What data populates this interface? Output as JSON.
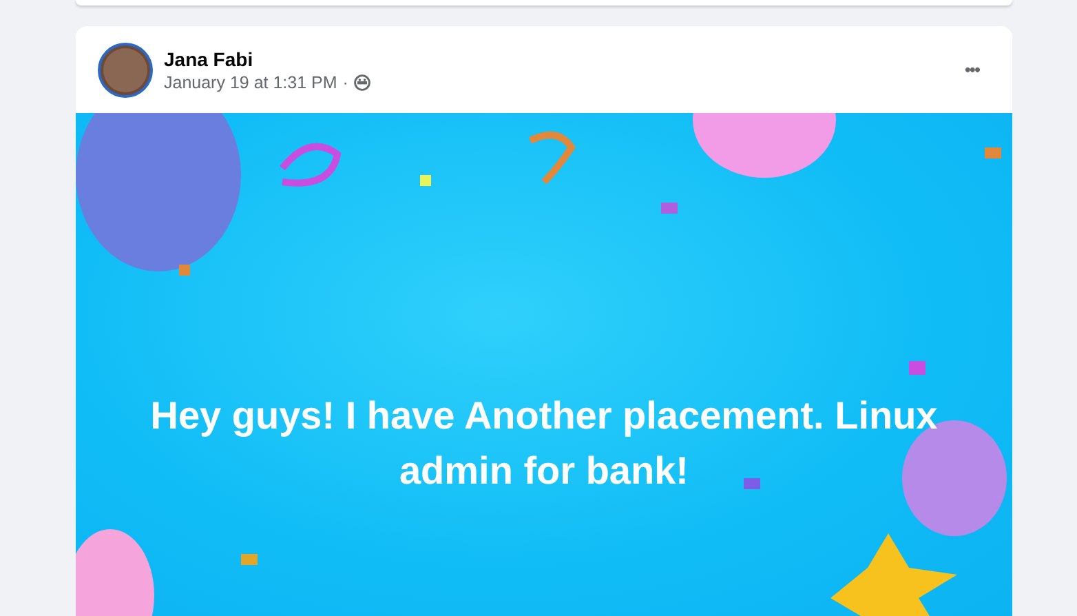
{
  "post": {
    "author": "Jana Fabi",
    "timestamp": "January 19 at 1:31 PM",
    "separator": "·",
    "more_menu": "•••",
    "text": "Hey guys! I have Another placement. Linux admin for bank!"
  }
}
